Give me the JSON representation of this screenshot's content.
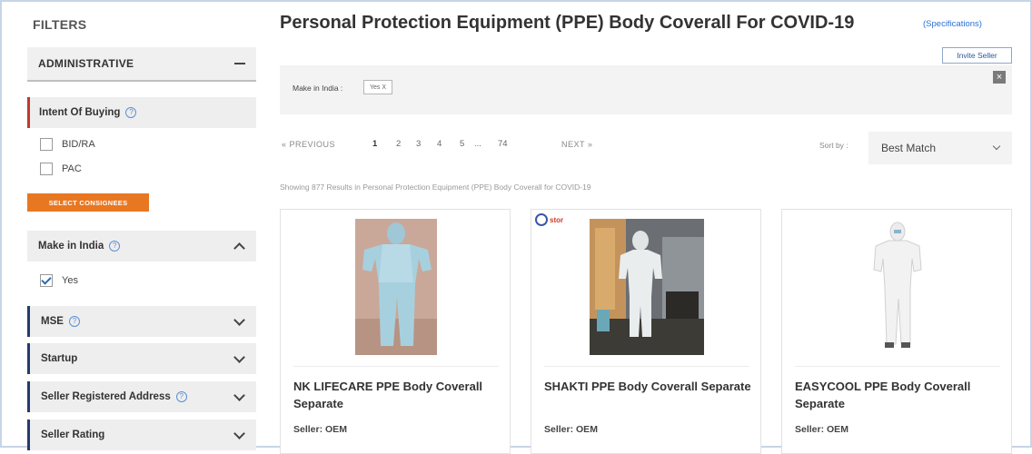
{
  "sidebar": {
    "title": "FILTERS",
    "administrative": {
      "label": "ADMINISTRATIVE"
    },
    "intent": {
      "label": "Intent Of Buying",
      "options": [
        {
          "label": "BID/RA",
          "checked": false
        },
        {
          "label": "PAC",
          "checked": false
        }
      ]
    },
    "select_consignees_label": "SELECT CONSIGNEES",
    "make_in_india": {
      "label": "Make in India",
      "options": [
        {
          "label": "Yes",
          "checked": true
        }
      ]
    },
    "collapsed_sections": [
      {
        "label": "MSE",
        "help": true
      },
      {
        "label": "Startup",
        "help": false
      },
      {
        "label": "Seller Registered Address",
        "help": true
      },
      {
        "label": "Seller Rating",
        "help": false
      }
    ],
    "help_glyph": "?"
  },
  "main": {
    "title": "Personal Protection Equipment (PPE) Body Coverall For COVID-19",
    "spec_link": "(Specifications)",
    "invite_seller": "Invite Seller",
    "applied_filter_label": "Make in India :",
    "applied_filter_chip": "Yes  X",
    "clear_icon": "×",
    "pagination": {
      "previous": "« PREVIOUS",
      "pages": [
        "1",
        "2",
        "3",
        "4",
        "5",
        "...",
        "74"
      ],
      "active_page": "1",
      "next": "NEXT »"
    },
    "sort": {
      "label": "Sort by :",
      "value": "Best Match"
    },
    "results_text": "Showing 877 Results in Personal Protection Equipment (PPE) Body Coverall for COVID-19"
  },
  "products": [
    {
      "name": "NK LIFECARE PPE Body Coverall Separate",
      "seller": "Seller: OEM",
      "icon": "ppe-photo-blue"
    },
    {
      "name": "SHAKTI PPE Body Coverall Separate",
      "seller": "Seller: OEM",
      "icon": "ppe-photo-room",
      "badge": "stor"
    },
    {
      "name": "EASYCOOL PPE Body Coverall Separate",
      "seller": "Seller: OEM",
      "icon": "ppe-photo-white"
    }
  ],
  "colors": {
    "accent_orange": "#e87722",
    "accent_red": "#c0392b",
    "accent_navy": "#253a6e",
    "link_blue": "#2a6fd6"
  }
}
